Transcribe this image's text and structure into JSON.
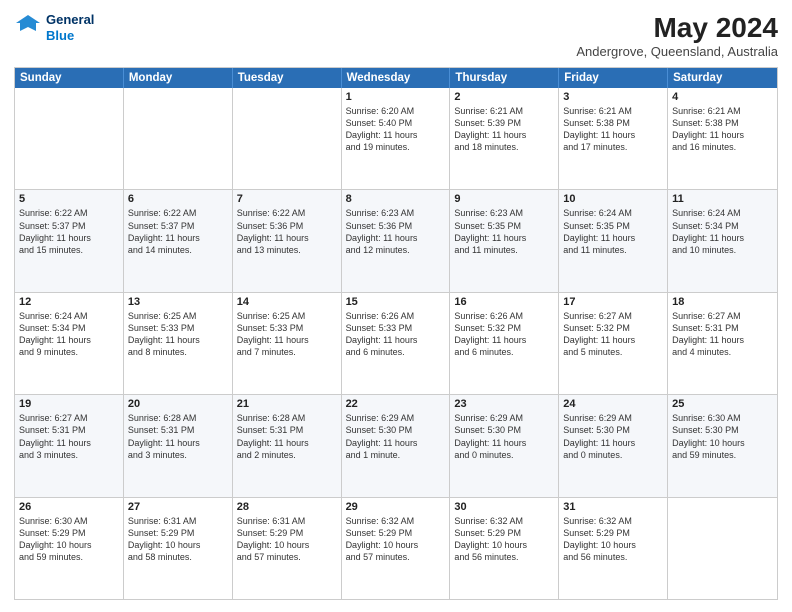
{
  "logo": {
    "line1": "General",
    "line2": "Blue"
  },
  "title": "May 2024",
  "location": "Andergrove, Queensland, Australia",
  "weekdays": [
    "Sunday",
    "Monday",
    "Tuesday",
    "Wednesday",
    "Thursday",
    "Friday",
    "Saturday"
  ],
  "weeks": [
    [
      {
        "day": "",
        "text": ""
      },
      {
        "day": "",
        "text": ""
      },
      {
        "day": "",
        "text": ""
      },
      {
        "day": "1",
        "text": "Sunrise: 6:20 AM\nSunset: 5:40 PM\nDaylight: 11 hours\nand 19 minutes."
      },
      {
        "day": "2",
        "text": "Sunrise: 6:21 AM\nSunset: 5:39 PM\nDaylight: 11 hours\nand 18 minutes."
      },
      {
        "day": "3",
        "text": "Sunrise: 6:21 AM\nSunset: 5:38 PM\nDaylight: 11 hours\nand 17 minutes."
      },
      {
        "day": "4",
        "text": "Sunrise: 6:21 AM\nSunset: 5:38 PM\nDaylight: 11 hours\nand 16 minutes."
      }
    ],
    [
      {
        "day": "5",
        "text": "Sunrise: 6:22 AM\nSunset: 5:37 PM\nDaylight: 11 hours\nand 15 minutes."
      },
      {
        "day": "6",
        "text": "Sunrise: 6:22 AM\nSunset: 5:37 PM\nDaylight: 11 hours\nand 14 minutes."
      },
      {
        "day": "7",
        "text": "Sunrise: 6:22 AM\nSunset: 5:36 PM\nDaylight: 11 hours\nand 13 minutes."
      },
      {
        "day": "8",
        "text": "Sunrise: 6:23 AM\nSunset: 5:36 PM\nDaylight: 11 hours\nand 12 minutes."
      },
      {
        "day": "9",
        "text": "Sunrise: 6:23 AM\nSunset: 5:35 PM\nDaylight: 11 hours\nand 11 minutes."
      },
      {
        "day": "10",
        "text": "Sunrise: 6:24 AM\nSunset: 5:35 PM\nDaylight: 11 hours\nand 11 minutes."
      },
      {
        "day": "11",
        "text": "Sunrise: 6:24 AM\nSunset: 5:34 PM\nDaylight: 11 hours\nand 10 minutes."
      }
    ],
    [
      {
        "day": "12",
        "text": "Sunrise: 6:24 AM\nSunset: 5:34 PM\nDaylight: 11 hours\nand 9 minutes."
      },
      {
        "day": "13",
        "text": "Sunrise: 6:25 AM\nSunset: 5:33 PM\nDaylight: 11 hours\nand 8 minutes."
      },
      {
        "day": "14",
        "text": "Sunrise: 6:25 AM\nSunset: 5:33 PM\nDaylight: 11 hours\nand 7 minutes."
      },
      {
        "day": "15",
        "text": "Sunrise: 6:26 AM\nSunset: 5:33 PM\nDaylight: 11 hours\nand 6 minutes."
      },
      {
        "day": "16",
        "text": "Sunrise: 6:26 AM\nSunset: 5:32 PM\nDaylight: 11 hours\nand 6 minutes."
      },
      {
        "day": "17",
        "text": "Sunrise: 6:27 AM\nSunset: 5:32 PM\nDaylight: 11 hours\nand 5 minutes."
      },
      {
        "day": "18",
        "text": "Sunrise: 6:27 AM\nSunset: 5:31 PM\nDaylight: 11 hours\nand 4 minutes."
      }
    ],
    [
      {
        "day": "19",
        "text": "Sunrise: 6:27 AM\nSunset: 5:31 PM\nDaylight: 11 hours\nand 3 minutes."
      },
      {
        "day": "20",
        "text": "Sunrise: 6:28 AM\nSunset: 5:31 PM\nDaylight: 11 hours\nand 3 minutes."
      },
      {
        "day": "21",
        "text": "Sunrise: 6:28 AM\nSunset: 5:31 PM\nDaylight: 11 hours\nand 2 minutes."
      },
      {
        "day": "22",
        "text": "Sunrise: 6:29 AM\nSunset: 5:30 PM\nDaylight: 11 hours\nand 1 minute."
      },
      {
        "day": "23",
        "text": "Sunrise: 6:29 AM\nSunset: 5:30 PM\nDaylight: 11 hours\nand 0 minutes."
      },
      {
        "day": "24",
        "text": "Sunrise: 6:29 AM\nSunset: 5:30 PM\nDaylight: 11 hours\nand 0 minutes."
      },
      {
        "day": "25",
        "text": "Sunrise: 6:30 AM\nSunset: 5:30 PM\nDaylight: 10 hours\nand 59 minutes."
      }
    ],
    [
      {
        "day": "26",
        "text": "Sunrise: 6:30 AM\nSunset: 5:29 PM\nDaylight: 10 hours\nand 59 minutes."
      },
      {
        "day": "27",
        "text": "Sunrise: 6:31 AM\nSunset: 5:29 PM\nDaylight: 10 hours\nand 58 minutes."
      },
      {
        "day": "28",
        "text": "Sunrise: 6:31 AM\nSunset: 5:29 PM\nDaylight: 10 hours\nand 57 minutes."
      },
      {
        "day": "29",
        "text": "Sunrise: 6:32 AM\nSunset: 5:29 PM\nDaylight: 10 hours\nand 57 minutes."
      },
      {
        "day": "30",
        "text": "Sunrise: 6:32 AM\nSunset: 5:29 PM\nDaylight: 10 hours\nand 56 minutes."
      },
      {
        "day": "31",
        "text": "Sunrise: 6:32 AM\nSunset: 5:29 PM\nDaylight: 10 hours\nand 56 minutes."
      },
      {
        "day": "",
        "text": ""
      }
    ]
  ]
}
